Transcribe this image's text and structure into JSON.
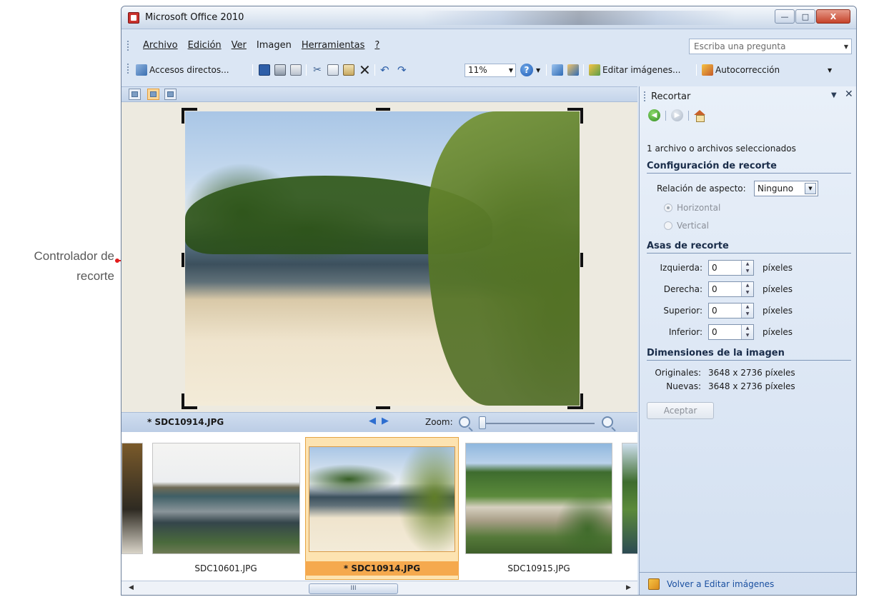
{
  "annotation": {
    "line1": "Controlador de",
    "line2": "recorte"
  },
  "window": {
    "title": "Microsoft Office 2010",
    "min_icon": "minimize-icon",
    "max_icon": "maximize-icon",
    "close_label": "X"
  },
  "menu": {
    "items": [
      "Archivo",
      "Edición",
      "Ver",
      "Imagen",
      "Herramientas",
      "?"
    ],
    "ask_placeholder": "Escriba una pregunta"
  },
  "toolbar": {
    "shortcuts_label": "Accesos directos...",
    "zoom_value": "11%",
    "edit_images_label": "Editar imágenes...",
    "autocorrect_label": "Autocorrección"
  },
  "viewer": {
    "filename": "* SDC10914.JPG",
    "zoom_label": "Zoom:"
  },
  "filmstrip": {
    "items": [
      {
        "label": "SDC10601.JPG",
        "selected": false
      },
      {
        "label": "* SDC10914.JPG",
        "selected": true
      },
      {
        "label": "SDC10915.JPG",
        "selected": false
      }
    ]
  },
  "scrollbar": {
    "thumb_glyph": "III"
  },
  "pane": {
    "title": "Recortar",
    "selected_info": "1 archivo o archivos seleccionados",
    "section_crop_settings": "Configuración de recorte",
    "aspect_label": "Relación de aspecto:",
    "aspect_value": "Ninguno",
    "radio_horizontal": "Horizontal",
    "radio_vertical": "Vertical",
    "section_handles": "Asas de recorte",
    "handles": [
      {
        "label": "Izquierda:",
        "value": "0",
        "unit": "píxeles"
      },
      {
        "label": "Derecha:",
        "value": "0",
        "unit": "píxeles"
      },
      {
        "label": "Superior:",
        "value": "0",
        "unit": "píxeles"
      },
      {
        "label": "Inferior:",
        "value": "0",
        "unit": "píxeles"
      }
    ],
    "section_dimensions": "Dimensiones de la imagen",
    "original_label": "Originales:",
    "original_value": "3648 x 2736 píxeles",
    "new_label": "Nuevas:",
    "new_value": "3648 x 2736 píxeles",
    "accept_label": "Aceptar",
    "footer_link": "Volver a Editar imágenes"
  }
}
